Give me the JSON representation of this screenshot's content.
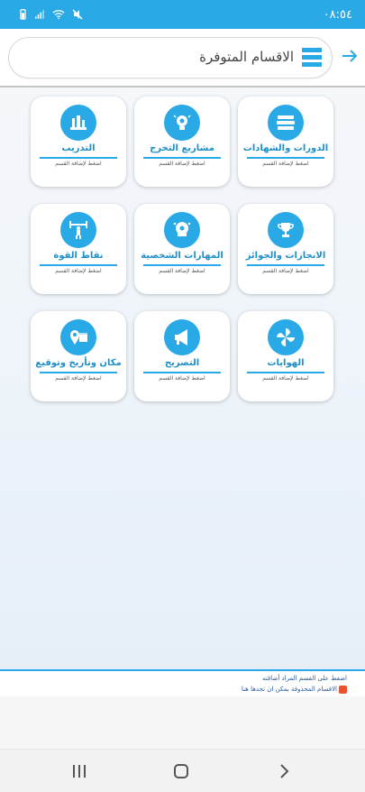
{
  "status_bar": {
    "time": "٠٨:٥٤",
    "icons": [
      "battery-icon",
      "signal-icon",
      "wifi-icon",
      "mute-icon"
    ],
    "background": "#29a9e6"
  },
  "header": {
    "title": "الاقسام المتوفرة",
    "menu_icon": "menu-icon",
    "back_icon": "arrow-right-icon"
  },
  "accent_color": "#29a9e6",
  "cards": [
    {
      "title": "الدورات والشهادات",
      "subtitle": "اضغط لإضافة القسم",
      "icon": "books-icon"
    },
    {
      "title": "مشاريع التخرج",
      "subtitle": "اضغط لإضافة القسم",
      "icon": "idea-gears-icon"
    },
    {
      "title": "التدريب",
      "subtitle": "اضغط لإضافة القسم",
      "icon": "lab-tools-icon"
    },
    {
      "title": "الانجازات والجوائز",
      "subtitle": "اضغط لإضافة القسم",
      "icon": "trophy-icon"
    },
    {
      "title": "المهارات الشخصية",
      "subtitle": "اضغط لإضافة القسم",
      "icon": "skills-head-icon"
    },
    {
      "title": "نقاط القوة",
      "subtitle": "اضغط لإضافة القسم",
      "icon": "weightlifter-icon"
    },
    {
      "title": "الهوايات",
      "subtitle": "اضغط لإضافة القسم",
      "icon": "pinwheel-icon"
    },
    {
      "title": "التصريح",
      "subtitle": "اضغط لإضافة القسم",
      "icon": "megaphone-icon"
    },
    {
      "title": "مكان وتأريخ وتوقيع",
      "subtitle": "اضغط لإضافة القسم",
      "icon": "calendar-location-icon"
    }
  ],
  "info": {
    "line1": "اضغط على القسم المراد أضافته",
    "line2": "الاقسام المحذوفة يمكن ان تجدها هنا"
  },
  "nav": {
    "recent_icon": "recent-apps-icon",
    "home_icon": "home-icon",
    "back_icon": "back-chevron-icon"
  }
}
